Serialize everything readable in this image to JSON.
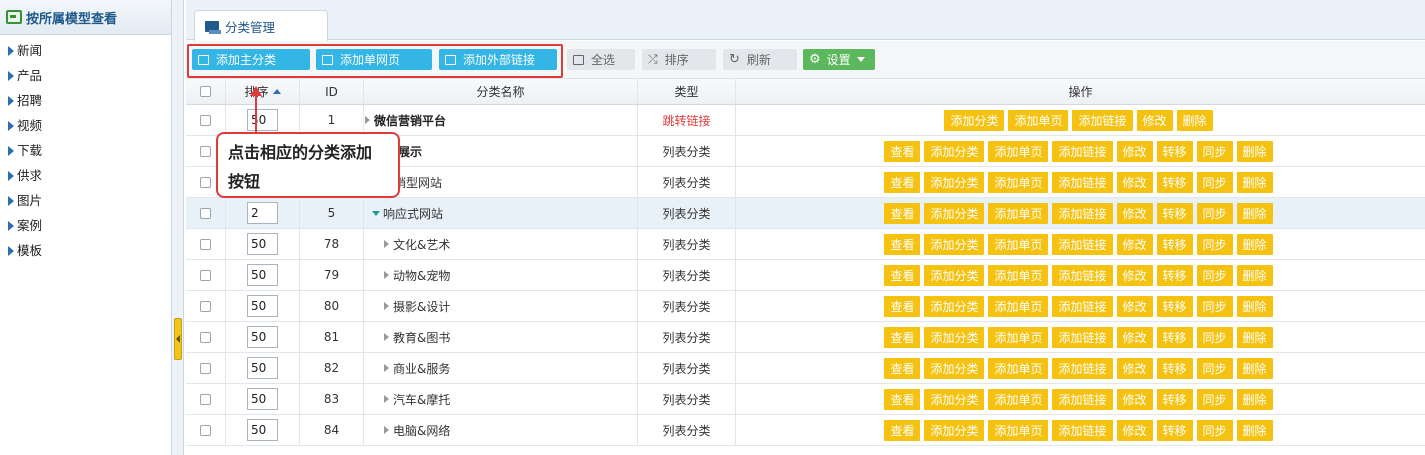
{
  "sidebar": {
    "title": "按所属模型查看",
    "items": [
      "新闻",
      "产品",
      "招聘",
      "视频",
      "下载",
      "供求",
      "图片",
      "案例",
      "模板"
    ]
  },
  "tab": {
    "label": "分类管理"
  },
  "toolbar": {
    "add_main": "添加主分类",
    "add_page": "添加单网页",
    "add_link": "添加外部链接",
    "select_all": "全选",
    "sort": "排序",
    "refresh": "刷新",
    "settings": "设置"
  },
  "table": {
    "headers": {
      "sort": "排序",
      "id": "ID",
      "name": "分类名称",
      "type": "类型",
      "ops": "操作"
    },
    "rows": [
      {
        "sort": "50",
        "id": "1",
        "name": "微信营销平台",
        "type": "跳转链接"
      },
      {
        "sort": "",
        "id": "",
        "name": "展示",
        "type": "列表分类"
      },
      {
        "sort": "",
        "id": "",
        "name": "销型网站",
        "type": "列表分类"
      },
      {
        "sort": "2",
        "id": "5",
        "name": "响应式网站",
        "type": "列表分类"
      },
      {
        "sort": "50",
        "id": "78",
        "name": "文化&艺术",
        "type": "列表分类"
      },
      {
        "sort": "50",
        "id": "79",
        "name": "动物&宠物",
        "type": "列表分类"
      },
      {
        "sort": "50",
        "id": "80",
        "name": "摄影&设计",
        "type": "列表分类"
      },
      {
        "sort": "50",
        "id": "81",
        "name": "教育&图书",
        "type": "列表分类"
      },
      {
        "sort": "50",
        "id": "82",
        "name": "商业&服务",
        "type": "列表分类"
      },
      {
        "sort": "50",
        "id": "83",
        "name": "汽车&摩托",
        "type": "列表分类"
      },
      {
        "sort": "50",
        "id": "84",
        "name": "电脑&网络",
        "type": "列表分类"
      }
    ],
    "ops_short": [
      "添加分类",
      "添加单页",
      "添加链接",
      "修改",
      "删除"
    ],
    "ops_full": [
      "查看",
      "添加分类",
      "添加单页",
      "添加链接",
      "修改",
      "转移",
      "同步",
      "删除"
    ]
  },
  "callout": {
    "text_line1": "点击相应的分类添加",
    "text_line2": "按钮"
  },
  "colors": {
    "accent_blue": "#33b5e5",
    "op_yellow": "#f5c211",
    "highlight_red": "#e03b3b",
    "settings_green": "#5cb85c"
  }
}
